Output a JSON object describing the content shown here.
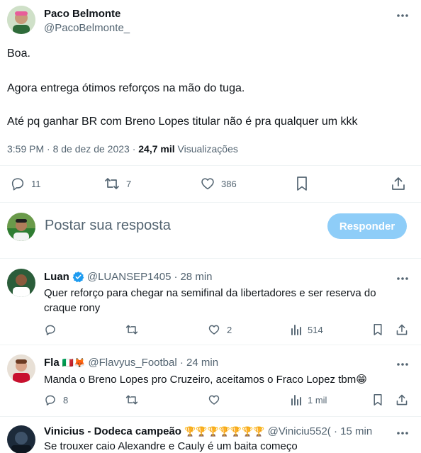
{
  "tweet": {
    "author_name": "Paco Belmonte",
    "author_handle": "@PacoBelmonte_",
    "lines": [
      "Boa.",
      "Agora entrega ótimos reforços na mão do tuga.",
      "Até pq ganhar BR com Breno Lopes titular não é pra qualquer um kkk"
    ],
    "time": "3:59 PM",
    "date": "8 de dez de 2023",
    "views_count": "24,7 mil",
    "views_label": "Visualizações",
    "replies": "11",
    "retweets": "7",
    "likes": "386"
  },
  "composer": {
    "placeholder": "Postar sua resposta",
    "button": "Responder"
  },
  "replies": [
    {
      "name": "Luan",
      "handle": "@LUANSEP1405",
      "time": "28 min",
      "text": "Quer reforço para chegar na semifinal da libertadores e ser reserva do craque rony",
      "replies": "",
      "retweets": "",
      "likes": "2",
      "views": "514"
    },
    {
      "name": "Fla",
      "name_emoji": "🇮🇹🦊",
      "handle": "@Flavyus_Footbal",
      "time": "24 min",
      "text": "Manda o Breno Lopes pro Cruzeiro, aceitamos o Fraco Lopez tbm😁",
      "replies": "8",
      "retweets": "",
      "likes": "",
      "views": "1 mil"
    },
    {
      "name": "Vinicius - Dodeca campeão",
      "name_emoji": "🏆🏆🏆🏆🏆🏆🏆",
      "handle": "@Viniciu552(",
      "time": "15 min",
      "text": "Se trouxer caio Alexandre e Cauly é um baita começo"
    }
  ],
  "sep": "·",
  "colors": {
    "text": "#0f1419",
    "secondary": "#536471",
    "accent": "#1d9bf0",
    "accent_disabled": "#8ecdf8",
    "verified": "#1d9bf0"
  }
}
